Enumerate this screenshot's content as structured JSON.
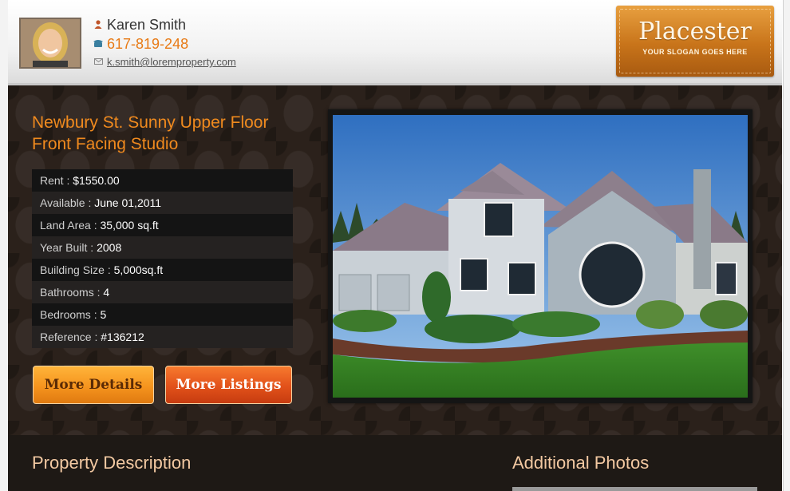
{
  "agent": {
    "name": "Karen Smith",
    "phone": "617-819-248",
    "email": "k.smith@loremproperty.com",
    "icons": {
      "name": "person-icon",
      "phone": "phone-icon",
      "email": "envelope-icon"
    }
  },
  "brand": {
    "name": "Placester",
    "slogan": "YOUR SLOGAN GOES HERE",
    "color": "#c8741a"
  },
  "listing": {
    "title": "Newbury St. Sunny Upper Floor Front Facing Studio",
    "details": [
      {
        "label": "Rent : ",
        "value": "$1550.00"
      },
      {
        "label": "Available : ",
        "value": "June 01,2011"
      },
      {
        "label": "Land Area : ",
        "value": "35,000 sq.ft"
      },
      {
        "label": "Year Built : ",
        "value": "2008"
      },
      {
        "label": "Building Size : ",
        "value": "5,000sq.ft"
      },
      {
        "label": "Bathrooms : ",
        "value": "4"
      },
      {
        "label": "Bedrooms : ",
        "value": "5"
      },
      {
        "label": "Reference : ",
        "value": "#136212"
      }
    ]
  },
  "buttons": {
    "more_details": "More Details",
    "more_listings": "More Listings"
  },
  "sections": {
    "property_description": "Property Description",
    "additional_photos": "Additional Photos"
  },
  "colors": {
    "accent_orange": "#f08a1e",
    "main_bg": "#2b211b"
  }
}
